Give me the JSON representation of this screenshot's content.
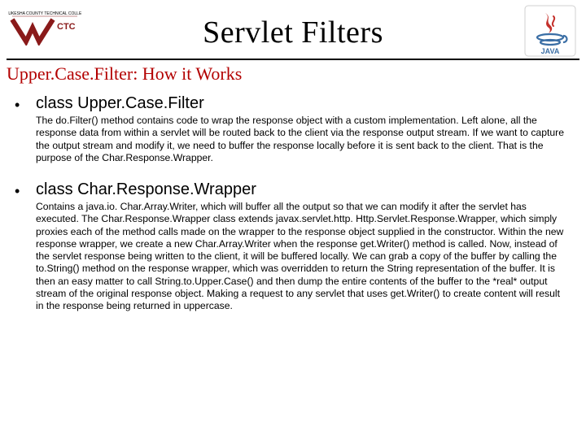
{
  "header": {
    "title": "Servlet Filters",
    "subtitle": "Upper.Case.Filter: How it Works",
    "logo_left_alt": "WCTC Waukesha County Technical College",
    "logo_right_alt": "Java"
  },
  "bullets": [
    {
      "heading": "class Upper.Case.Filter",
      "text": "The do.Filter() method contains code to wrap the response object with a custom implementation. Left alone, all the response data from within a servlet will be routed back to the client via the response output stream. If we want to capture the output stream and modify it, we need to buffer the response locally before it is sent back to the client. That is the purpose of the Char.Response.Wrapper."
    },
    {
      "heading": "class Char.Response.Wrapper",
      "text": "Contains a java.io. Char.Array.Writer, which will buffer all the output so that we can modify it after the servlet has executed. The Char.Response.Wrapper class extends javax.servlet.http. Http.Servlet.Response.Wrapper, which simply proxies each of the method calls made on the wrapper to the response object supplied in the constructor. Within the new response wrapper, we create a new Char.Array.Writer when the response get.Writer() method is called. Now, instead of the servlet response being written to the client, it will be buffered locally. We can grab a copy of the buffer by calling the to.String() method on the response wrapper, which was overridden to return the String representation of the buffer. It is then an easy matter to call String.to.Upper.Case() and then dump the entire contents of the buffer to the *real* output stream of the original response object. Making a request to any servlet that uses get.Writer() to create content will result in the response being returned in uppercase."
    }
  ]
}
